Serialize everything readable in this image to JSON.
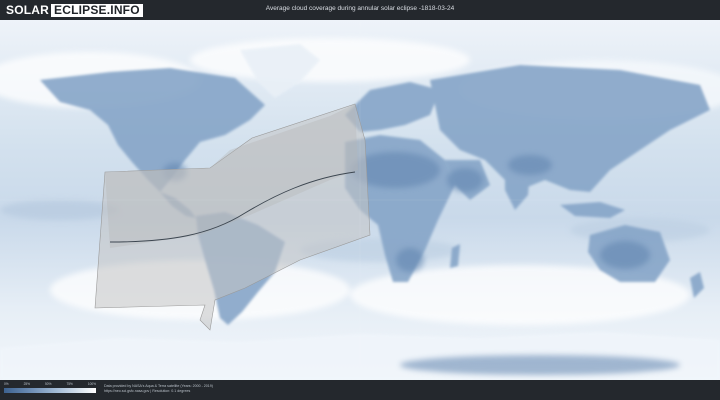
{
  "header": {
    "logo_part1": "SOLAR",
    "logo_part2": "ECLIPSE.INFO",
    "title": "Average cloud coverage during annular solar eclipse -1818-03-24"
  },
  "map": {
    "layer": "average cloud coverage",
    "colors": {
      "ocean_base": "#dde8f3",
      "land": "#7f9ec2",
      "eclipse_zone": "#c7c7c7",
      "path_line": "#3c4650",
      "polar_ice": "#f4f8fc"
    }
  },
  "legend": {
    "ticks": [
      "0%",
      "25%",
      "50%",
      "75%",
      "100%"
    ]
  },
  "footer": {
    "credit_line1": "Data provided by NASA's Aqua & Terra satellite (Years: 2000 - 2019)",
    "credit_line2": "https://neo.sci.gsfc.nasa.gov  |  Resolution: 0.1 degrees"
  }
}
